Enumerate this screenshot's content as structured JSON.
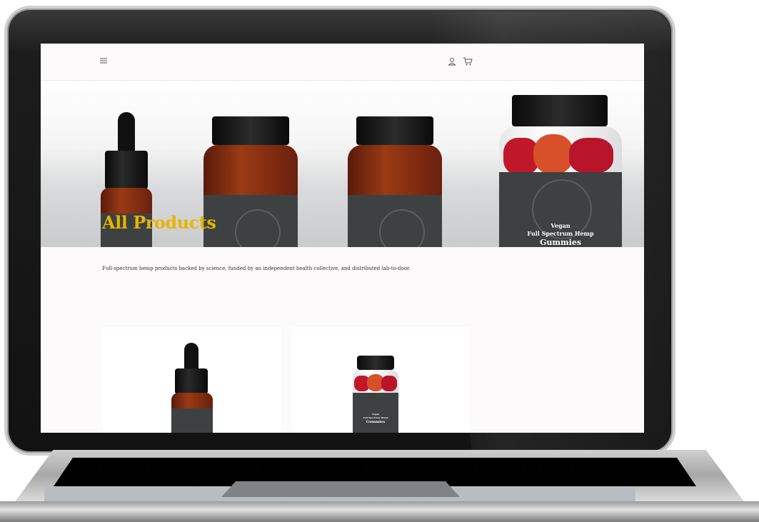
{
  "hero": {
    "title": "All Products"
  },
  "description": "Full-spectrum hemp products backed by science, funded by an independent health collective, and distributed lab-to-door.",
  "hero_gummies_label": {
    "line1": "Vegan",
    "line2": "Full Spectrum Hemp",
    "line3": "Gummies"
  },
  "card_gummies_label": {
    "line1": "Vegan",
    "line2": "Full Spectrum Hemp",
    "line3": "Gummies"
  },
  "icons": {
    "menu": "menu-icon",
    "account": "account-icon",
    "cart": "cart-icon"
  },
  "colors": {
    "title": "#e8b400",
    "label": "#3d4142",
    "background": "#fcfafa"
  }
}
